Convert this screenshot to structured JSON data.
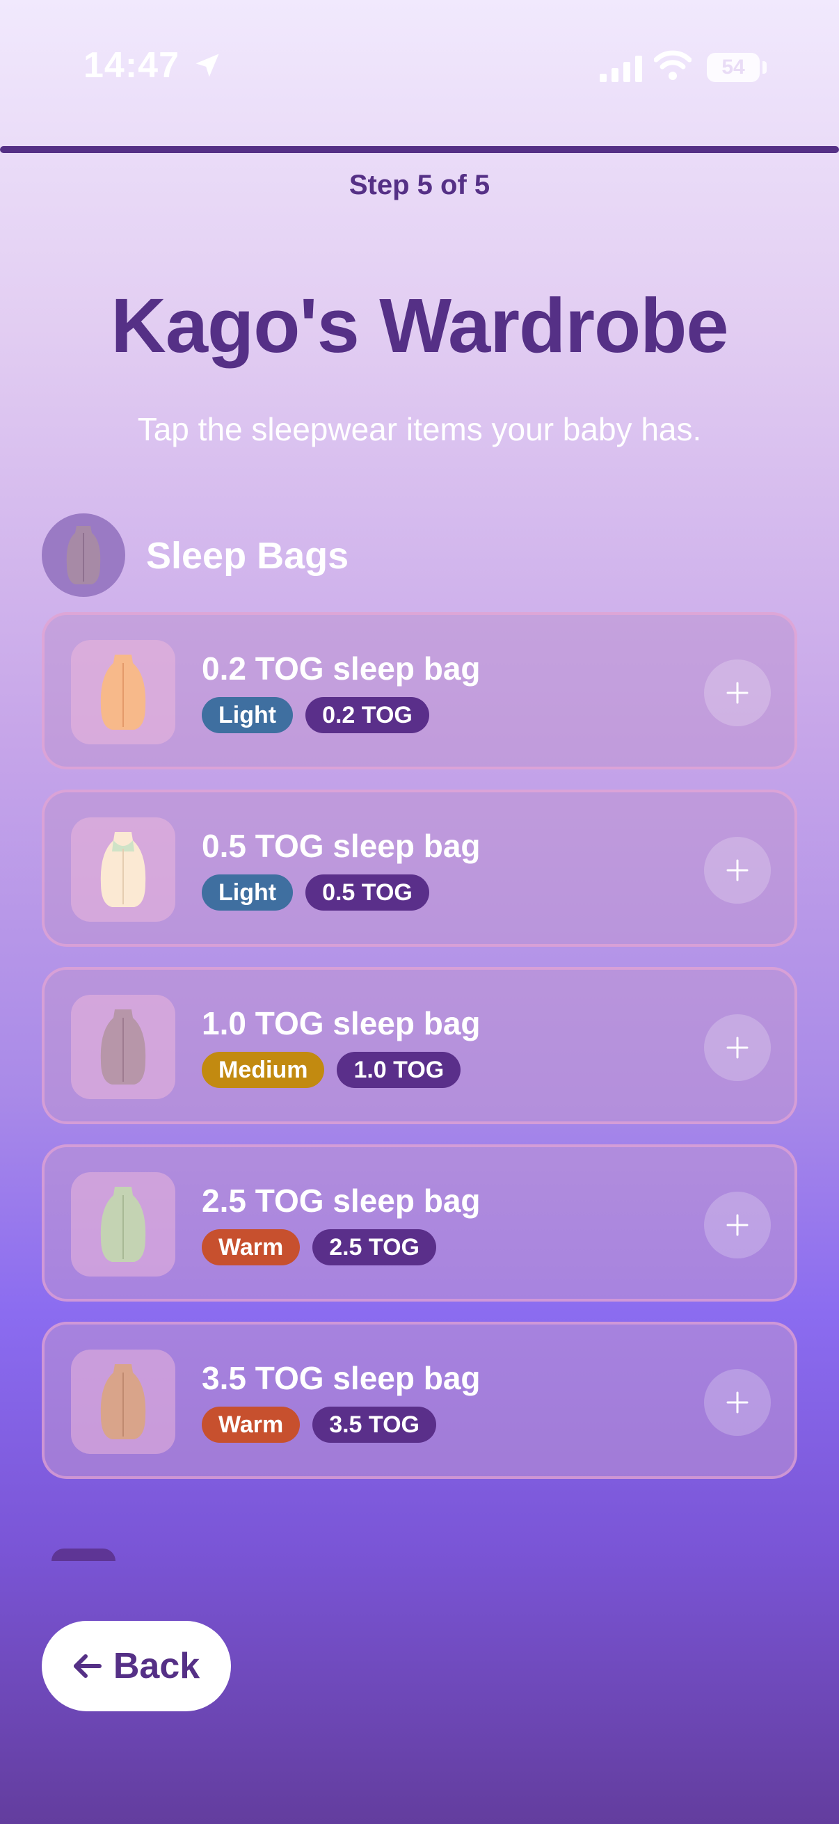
{
  "status_bar": {
    "time": "14:47",
    "battery": "54",
    "icons": [
      "location-arrow-icon",
      "cellular-signal-icon",
      "wifi-icon",
      "battery-icon"
    ]
  },
  "progress": {
    "step_label": "Step 5 of 5",
    "fraction": 1.0,
    "color": "#553086"
  },
  "header": {
    "title": "Kago's Wardrobe",
    "subtitle": "Tap the sleepwear items your baby has."
  },
  "section": {
    "title": "Sleep Bags",
    "icon": "sleep-bag-icon"
  },
  "colors": {
    "brand": "#553086",
    "tag_light": "#3f6fa0",
    "tag_medium": "#c28a10",
    "tag_warm": "#c7502e",
    "tag_tog": "#5a2f8a"
  },
  "items": [
    {
      "title": "0.2 TOG sleep bag",
      "warmth": "Light",
      "tog": "0.2 TOG",
      "warmth_level": "light",
      "image": "peach-sleep-bag"
    },
    {
      "title": "0.5 TOG sleep bag",
      "warmth": "Light",
      "tog": "0.5 TOG",
      "warmth_level": "light",
      "image": "cream-sleep-bag"
    },
    {
      "title": "1.0 TOG sleep bag",
      "warmth": "Medium",
      "tog": "1.0 TOG",
      "warmth_level": "medium",
      "image": "mauve-sleep-bag"
    },
    {
      "title": "2.5 TOG sleep bag",
      "warmth": "Warm",
      "tog": "2.5 TOG",
      "warmth_level": "warm",
      "image": "sage-sleep-bag"
    },
    {
      "title": "3.5 TOG sleep bag",
      "warmth": "Warm",
      "tog": "3.5 TOG",
      "warmth_level": "warm",
      "image": "tan-sleep-bag"
    }
  ],
  "footer": {
    "back_label": "Back",
    "back_icon": "arrow-left-icon"
  }
}
